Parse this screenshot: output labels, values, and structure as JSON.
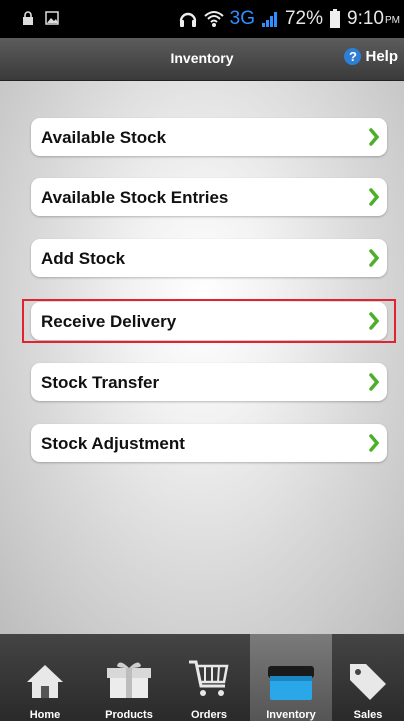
{
  "status_bar": {
    "network": "3G",
    "battery": "72%",
    "time": "9:10",
    "time_suffix": "PM"
  },
  "header": {
    "title": "Inventory",
    "help_label": "Help",
    "help_icon": "?"
  },
  "menu": {
    "items": [
      {
        "label": "Available Stock"
      },
      {
        "label": "Available Stock Entries"
      },
      {
        "label": "Add Stock"
      },
      {
        "label": "Receive Delivery"
      },
      {
        "label": "Stock Transfer"
      },
      {
        "label": "Stock Adjustment"
      }
    ]
  },
  "tabs": {
    "items": [
      {
        "label": "Home",
        "icon": "home-icon"
      },
      {
        "label": "Products",
        "icon": "gift-box-icon"
      },
      {
        "label": "Orders",
        "icon": "shopping-cart-icon"
      },
      {
        "label": "Inventory",
        "icon": "storage-box-icon"
      },
      {
        "label": "Sales",
        "icon": "price-tag-icon"
      }
    ],
    "active": "Inventory"
  },
  "colors": {
    "chevron": "#4caf2a",
    "highlight": "#e0242f",
    "active_tab_icon": "#29a7e8",
    "help_icon": "#2d7fd6"
  }
}
